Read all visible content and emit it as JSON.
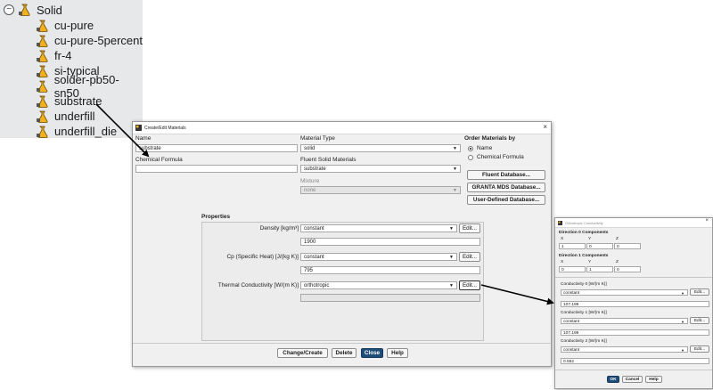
{
  "tree": {
    "root_label": "Solid",
    "collapse_glyph": "−",
    "items": [
      {
        "label": "cu-pure"
      },
      {
        "label": "cu-pure-5percent"
      },
      {
        "label": "fr-4"
      },
      {
        "label": "si-typical"
      },
      {
        "label": "solder-pb50-sn50"
      },
      {
        "label": "substrate"
      },
      {
        "label": "underfill"
      },
      {
        "label": "underfill_die"
      }
    ]
  },
  "main_dialog": {
    "title": "Create/Edit Materials",
    "close_glyph": "×",
    "name_label": "Name",
    "name_value": "substrate",
    "formula_label": "Chemical Formula",
    "formula_value": "",
    "material_type_label": "Material Type",
    "material_type_value": "solid",
    "fluent_solid_label": "Fluent Solid Materials",
    "fluent_solid_value": "substrate",
    "mixture_label": "Mixture",
    "mixture_value": "none",
    "order_label": "Order Materials by",
    "order_options": [
      {
        "label": "Name",
        "selected": true
      },
      {
        "label": "Chemical Formula",
        "selected": false
      }
    ],
    "db_buttons": [
      "Fluent Database...",
      "GRANTA MDS Database...",
      "User-Defined Database..."
    ],
    "properties_label": "Properties",
    "properties": [
      {
        "label": "Density [kg/m³]",
        "method": "constant",
        "edit": "Edit...",
        "value": "1900"
      },
      {
        "label": "Cp (Specific Heat) [J/(kg K)]",
        "method": "constant",
        "edit": "Edit...",
        "value": "795"
      },
      {
        "label": "Thermal Conductivity [W/(m K)]",
        "method": "orthotropic",
        "edit": "Edit...",
        "value": ""
      }
    ],
    "bottom_buttons": {
      "create": "Change/Create",
      "delete": "Delete",
      "close": "Close",
      "help": "Help"
    }
  },
  "ortho_dialog": {
    "title": "Orthotropic Conductivity",
    "close_glyph": "×",
    "dir0_label": "Direction 0 Components",
    "dir0": {
      "headers": [
        "X",
        "Y",
        "Z"
      ],
      "values": [
        "1",
        "0",
        "0"
      ]
    },
    "dir1_label": "Direction 1 Components",
    "dir1": {
      "headers": [
        "X",
        "Y",
        "Z"
      ],
      "values": [
        "0",
        "1",
        "0"
      ]
    },
    "conductivities": [
      {
        "label": "Conductivity 0 [W/(m K)]",
        "method": "constant",
        "edit": "Edit...",
        "value": "107.199"
      },
      {
        "label": "Conductivity 1 [W/(m K)]",
        "method": "constant",
        "edit": "Edit...",
        "value": "107.199"
      },
      {
        "label": "Conductivity 2 [W/(m K)]",
        "method": "constant",
        "edit": "Edit...",
        "value": "0.552"
      }
    ],
    "buttons": {
      "ok": "OK",
      "cancel": "Cancel",
      "help": "Help"
    }
  },
  "icons": {
    "material": "material-flask-icon",
    "app": "fluent-app-icon",
    "dropdown": "dropdown-arrow-icon"
  },
  "colors": {
    "tree_bg": "#e6e8ea",
    "dialog_bg": "#f0f0f0",
    "primary_button": "#1f4d7a",
    "arrow": "#000000"
  }
}
